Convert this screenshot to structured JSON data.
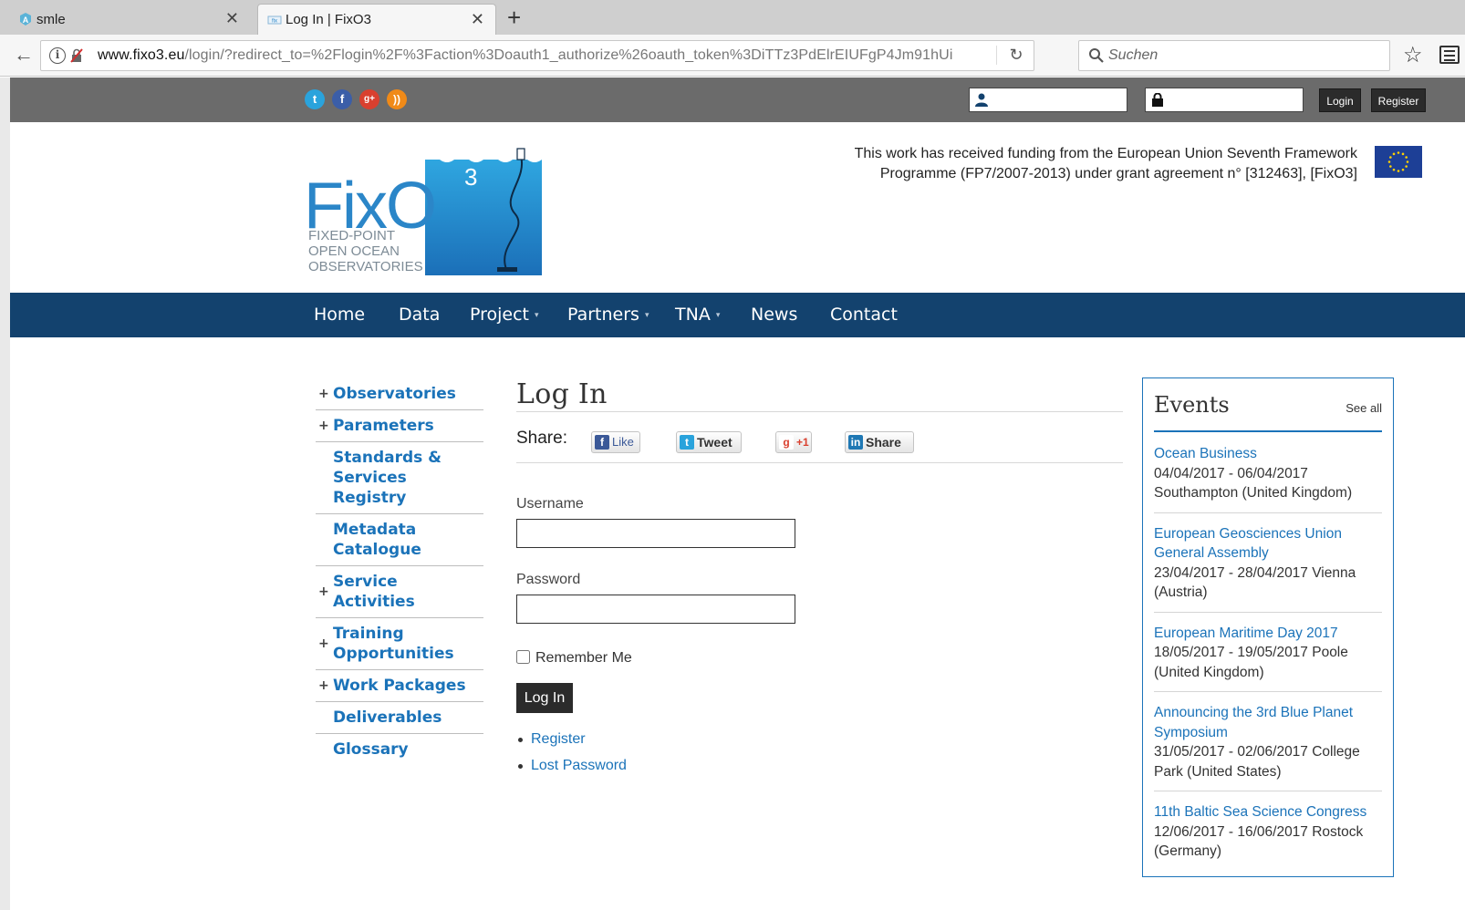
{
  "browser": {
    "tabs": [
      {
        "label": "smle",
        "icon": "smle-favicon-icon"
      },
      {
        "label": "Log In | FixO3",
        "icon": "fixo3-favicon-icon"
      }
    ],
    "url": {
      "host": "www.fixo3.eu",
      "path": "/login/?redirect_to=%2Flogin%2F%3Faction%3Doauth1_authorize%26oauth_token%3DiTTz3PdElrEIUFgP4Jm91hUi"
    },
    "search_placeholder": "Suchen"
  },
  "topbar": {
    "social": [
      "twitter-icon",
      "facebook-icon",
      "google-plus-icon",
      "rss-icon"
    ],
    "login_label": "Login",
    "register_label": "Register"
  },
  "header": {
    "funding_text": "This work has received funding from the European Union Seventh Framework Programme (FP7/2007-2013) under grant agreement n° [312463], [FixO3]",
    "logo": {
      "name": "FixO",
      "superscript": "3",
      "tagline_1": "FIXED-POINT",
      "tagline_2": "OPEN OCEAN",
      "tagline_3": "OBSERVATORIES"
    }
  },
  "nav": {
    "items": [
      {
        "label": "Home",
        "dropdown": false
      },
      {
        "label": "Data",
        "dropdown": false
      },
      {
        "label": "Project",
        "dropdown": true
      },
      {
        "label": "Partners",
        "dropdown": true
      },
      {
        "label": "TNA",
        "dropdown": true
      },
      {
        "label": "News",
        "dropdown": false
      },
      {
        "label": "Contact",
        "dropdown": false
      }
    ],
    "caret": "▾"
  },
  "sidebar": {
    "items": [
      {
        "label": "Observatories",
        "expandable": true
      },
      {
        "label": "Parameters",
        "expandable": true
      },
      {
        "label": "Standards & Services Registry",
        "expandable": false
      },
      {
        "label": "Metadata Catalogue",
        "expandable": false
      },
      {
        "label": "Service Activities",
        "expandable": true
      },
      {
        "label": "Training Opportunities",
        "expandable": true
      },
      {
        "label": "Work Packages",
        "expandable": true
      },
      {
        "label": "Deliverables",
        "expandable": false
      },
      {
        "label": "Glossary",
        "expandable": false
      }
    ],
    "plus": "+"
  },
  "main": {
    "title": "Log In",
    "share_label": "Share:",
    "share_buttons": {
      "like": "Like",
      "tweet": "Tweet",
      "plus": "+1",
      "share": "Share"
    },
    "username_label": "Username",
    "password_label": "Password",
    "remember_label": "Remember Me",
    "submit_label": "Log In",
    "links": [
      "Register",
      "Lost Password"
    ]
  },
  "events": {
    "title": "Events",
    "see_all": "See all",
    "items": [
      {
        "title": "Ocean Business",
        "info": "04/04/2017 - 06/04/2017 Southampton (United Kingdom)"
      },
      {
        "title": "European Geosciences Union General Assembly",
        "info": "23/04/2017 - 28/04/2017 Vienna (Austria)"
      },
      {
        "title": "European Maritime Day 2017",
        "info": "18/05/2017 - 19/05/2017 Poole (United Kingdom)"
      },
      {
        "title": "Announcing the 3rd Blue Planet Symposium",
        "info": "31/05/2017 - 02/06/2017 College Park (United States)"
      },
      {
        "title": "11th Baltic Sea Science Congress",
        "info": "12/06/2017 - 16/06/2017 Rostock (Germany)"
      }
    ]
  },
  "colors": {
    "nav_bg": "#13426e",
    "topbar_bg": "#6b6b6b",
    "link": "#1b73b9",
    "logo_blue": "#2b86c8"
  }
}
